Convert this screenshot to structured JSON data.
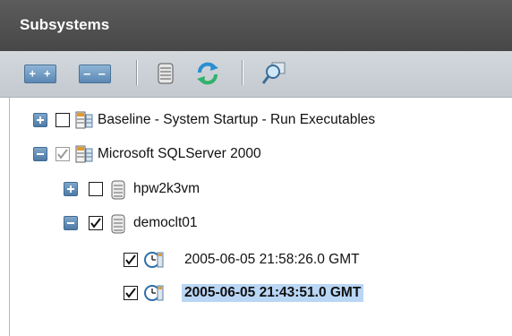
{
  "panel": {
    "title": "Subsystems"
  },
  "toolbar": {
    "expand_all_glyph": "+ +",
    "collapse_all_glyph": "– –",
    "buttons": [
      "expand-all",
      "collapse-all",
      "database-icon",
      "refresh-icon",
      "search-icon"
    ]
  },
  "tree": {
    "items": [
      {
        "label": "Baseline - System Startup - Run Executables",
        "expander": "plus",
        "checked": false,
        "icon": "system-table-icon"
      },
      {
        "label": "Microsoft SQLServer 2000",
        "expander": "minus",
        "checked": true,
        "checkbox_dimmed": true,
        "icon": "system-table-icon"
      },
      {
        "label": "hpw2k3vm",
        "expander": "plus",
        "checked": false,
        "icon": "server-icon"
      },
      {
        "label": "democlt01",
        "expander": "minus",
        "checked": true,
        "icon": "server-icon"
      },
      {
        "label": "2005-06-05 21:58:26.0 GMT",
        "checked": true,
        "icon": "snapshot-clock-icon"
      },
      {
        "label": "2005-06-05 21:43:51.0 GMT",
        "checked": true,
        "icon": "snapshot-clock-icon",
        "selected": true
      }
    ]
  },
  "colors": {
    "title_bar": "#4f4f4f",
    "toolbar": "#cbd0d5",
    "selection": "#b9d6f5",
    "expander": "#5e8ab4"
  }
}
